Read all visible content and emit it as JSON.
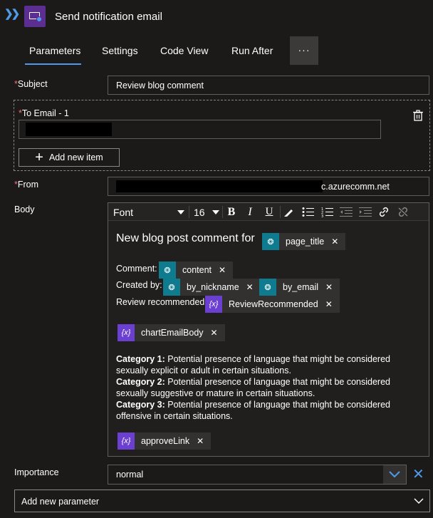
{
  "header": {
    "title": "Send notification email",
    "expand_icon": "double-chevron-right-icon",
    "app_icon": "notification-email-icon"
  },
  "tabs": [
    {
      "label": "Parameters",
      "active": true
    },
    {
      "label": "Settings"
    },
    {
      "label": "Code View"
    },
    {
      "label": "Run After"
    }
  ],
  "more_label": "···",
  "form": {
    "subject_label": "Subject",
    "subject_value": "Review blog comment",
    "to_email_label": "To Email - 1",
    "add_item_label": "Add new item",
    "from_label": "From",
    "from_value_suffix": "c.azurecomm.net",
    "body_label": "Body",
    "importance_label": "Importance",
    "importance_value": "normal",
    "add_parameter_label": "Add new parameter"
  },
  "toolbar": {
    "font_label": "Font",
    "size_label": "16",
    "bold": "B",
    "italic": "I",
    "underline": "U"
  },
  "editor": {
    "heading_text": "New blog post comment for",
    "heading_token": "page_title",
    "comment_label": "Comment:",
    "comment_token": "content",
    "created_by_label": "Created by:",
    "created_by_token1": "by_nickname",
    "created_by_token2": "by_email",
    "review_label": "Review recommended:",
    "review_token": "ReviewRecommended",
    "chart_token": "chartEmailBody",
    "cat1_label": "Category 1:",
    "cat1_text": " Potential presence of language that might be considered sexually explicit or adult in certain situations.",
    "cat2_label": "Category 2:",
    "cat2_text": " Potential presence of language that might be considered sexually suggestive or mature in certain situations.",
    "cat3_label": "Category 3:",
    "cat3_text": " Potential presence of language that might be considered offensive in certain situations.",
    "approve_token": "approveLink",
    "var_icon_text": "{x}"
  },
  "colors": {
    "background": "#1b1a19",
    "accent": "#4f9bea",
    "required": "#f1707b",
    "teal_token": "#0f7b8f",
    "purple_token": "#6b3fd1",
    "app_icon": "#5c2e91"
  }
}
